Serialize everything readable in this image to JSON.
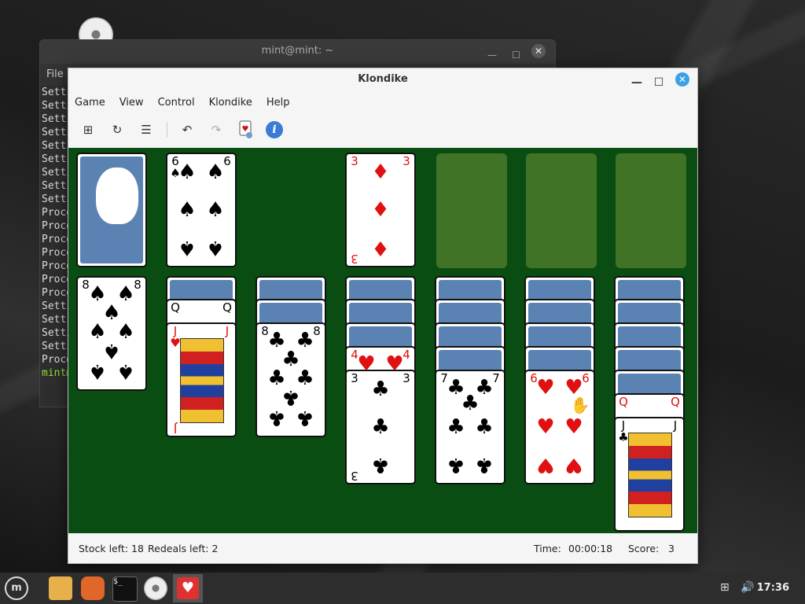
{
  "desktop": {
    "terminal": {
      "title": "mint@mint: ~",
      "menu_file": "File",
      "lines": [
        "Setti",
        "Setti",
        "Setti",
        "Setti",
        "Setti",
        "Setti",
        "Setti",
        "Setti",
        "Setti",
        "Proce",
        "Proce",
        "Proce",
        "Proce",
        "Proce",
        "Proce",
        "Proce",
        "Setti",
        "Setti",
        "Setti",
        "Setti",
        "Proce",
        "mint@"
      ]
    }
  },
  "window": {
    "title": "Klondike",
    "menu": [
      "Game",
      "View",
      "Control",
      "Klondike",
      "Help"
    ],
    "toolbar": {
      "new_icon": "⊞",
      "restart_icon": "↻",
      "scores_icon": "☰",
      "undo_icon": "↶",
      "redo_icon": "↷",
      "info_icon": "i"
    },
    "status": {
      "stock": "Stock left: 18",
      "redeals": "Redeals left: 2",
      "time_label": "Time:",
      "time_value": "00:00:18",
      "score_label": "Score:",
      "score_value": "3"
    }
  },
  "cards": {
    "waste": {
      "rank": "6",
      "suit": "♠"
    },
    "foundation1": {
      "rank": "3",
      "suit": "♦"
    },
    "col1": {
      "rank": "8",
      "suit": "♠"
    },
    "col2_mid": {
      "rank": "Q",
      "suit": "♥"
    },
    "col2_top": {
      "rank": "J",
      "suit": "♥"
    },
    "col3": {
      "rank": "8",
      "suit": "♣"
    },
    "col4_mid": {
      "rank": "4",
      "suit": "♥"
    },
    "col4_top": {
      "rank": "3",
      "suit": "♣"
    },
    "col5": {
      "rank": "7",
      "suit": "♣"
    },
    "col6": {
      "rank": "6",
      "suit": "♥"
    },
    "col7_mid": {
      "rank": "Q",
      "suit": "♣"
    },
    "col7_top": {
      "rank": "J",
      "suit": "♣"
    }
  },
  "taskbar": {
    "clock": "17:36",
    "menu_icon": "linux-mint-menu-icon",
    "apps": [
      "files-icon",
      "firefox-icon",
      "terminal-icon",
      "disc-icon",
      "solitaire-icon"
    ]
  },
  "colors": {
    "felt": "#0a4d12",
    "card_back": "#5a83b3",
    "slot": "#4a7a2a",
    "accent": "#3aa1e6"
  }
}
